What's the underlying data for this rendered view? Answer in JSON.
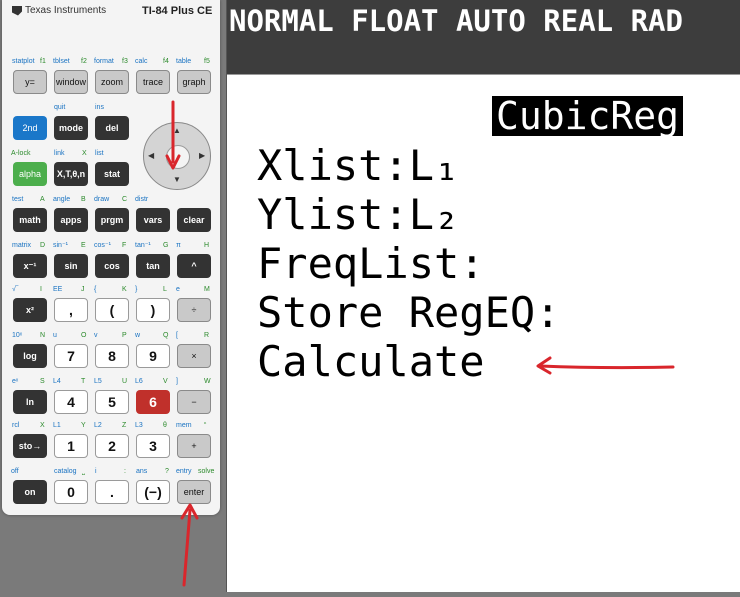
{
  "calculator": {
    "brand": "Texas Instruments",
    "model": "TI-84 Plus CE",
    "rows": [
      {
        "labels": [
          [
            "statplot",
            "b"
          ],
          [
            "f1",
            "g"
          ],
          [
            "tblset",
            "b"
          ],
          [
            "f2",
            "g"
          ],
          [
            "format",
            "b"
          ],
          [
            "f3",
            "g"
          ],
          [
            "calc",
            "b"
          ],
          [
            "f4",
            "g"
          ],
          [
            "table",
            "b"
          ],
          [
            "f5",
            "g"
          ]
        ],
        "keys": [
          [
            "y=",
            "gray"
          ],
          [
            "window",
            "gray"
          ],
          [
            "zoom",
            "gray"
          ],
          [
            "trace",
            "gray"
          ],
          [
            "graph",
            "gray"
          ]
        ]
      },
      {
        "labels": [
          [
            "quit",
            "b"
          ],
          [
            "ins",
            "b"
          ]
        ],
        "keys": [
          [
            "2nd",
            "blue"
          ],
          [
            "mode",
            "dark"
          ],
          [
            "del",
            "dark"
          ]
        ]
      },
      {
        "labels": [
          [
            "A-lock",
            "g"
          ],
          [
            "link",
            "b"
          ],
          [
            "X",
            "g"
          ],
          [
            "list",
            "b"
          ]
        ],
        "keys": [
          [
            "alpha",
            "green"
          ],
          [
            "X,T,θ,n",
            "dark"
          ],
          [
            "stat",
            "dark"
          ]
        ]
      },
      {
        "labels": [
          [
            "test",
            "b"
          ],
          [
            "A",
            "g"
          ],
          [
            "angle",
            "b"
          ],
          [
            "B",
            "g"
          ],
          [
            "draw",
            "b"
          ],
          [
            "C",
            "g"
          ],
          [
            "distr",
            "b"
          ]
        ],
        "keys": [
          [
            "math",
            "dark"
          ],
          [
            "apps",
            "dark"
          ],
          [
            "prgm",
            "dark"
          ],
          [
            "vars",
            "dark"
          ],
          [
            "clear",
            "dark"
          ]
        ]
      },
      {
        "labels": [
          [
            "matrix",
            "b"
          ],
          [
            "D",
            "g"
          ],
          [
            "sin⁻¹",
            "b"
          ],
          [
            "E",
            "g"
          ],
          [
            "cos⁻¹",
            "b"
          ],
          [
            "F",
            "g"
          ],
          [
            "tan⁻¹",
            "b"
          ],
          [
            "G",
            "g"
          ],
          [
            "π",
            "b"
          ],
          [
            "H",
            "g"
          ]
        ],
        "keys": [
          [
            "x⁻¹",
            "dark"
          ],
          [
            "sin",
            "dark"
          ],
          [
            "cos",
            "dark"
          ],
          [
            "tan",
            "dark"
          ],
          [
            "^",
            "dark"
          ]
        ]
      },
      {
        "labels": [
          [
            "√‾",
            "b"
          ],
          [
            "I",
            "g"
          ],
          [
            "EE",
            "b"
          ],
          [
            "J",
            "g"
          ],
          [
            "{",
            "b"
          ],
          [
            "K",
            "g"
          ],
          [
            "}",
            "b"
          ],
          [
            "L",
            "g"
          ],
          [
            "e",
            "b"
          ],
          [
            "M",
            "g"
          ]
        ],
        "keys": [
          [
            "x²",
            "dark"
          ],
          [
            ",",
            "white"
          ],
          [
            "(",
            "white"
          ],
          [
            ")",
            "white"
          ],
          [
            "÷",
            "gray"
          ]
        ]
      },
      {
        "labels": [
          [
            "10ˣ",
            "b"
          ],
          [
            "N",
            "g"
          ],
          [
            "u",
            "b"
          ],
          [
            "O",
            "g"
          ],
          [
            "v",
            "b"
          ],
          [
            "P",
            "g"
          ],
          [
            "w",
            "b"
          ],
          [
            "Q",
            "g"
          ],
          [
            "[",
            "b"
          ],
          [
            "R",
            "g"
          ]
        ],
        "keys": [
          [
            "log",
            "dark"
          ],
          [
            "7",
            "white"
          ],
          [
            "8",
            "white"
          ],
          [
            "9",
            "white"
          ],
          [
            "×",
            "gray"
          ]
        ]
      },
      {
        "labels": [
          [
            "eˣ",
            "b"
          ],
          [
            "S",
            "g"
          ],
          [
            "L4",
            "b"
          ],
          [
            "T",
            "g"
          ],
          [
            "L5",
            "b"
          ],
          [
            "U",
            "g"
          ],
          [
            "L6",
            "b"
          ],
          [
            "V",
            "g"
          ],
          [
            "]",
            "b"
          ],
          [
            "W",
            "g"
          ]
        ],
        "keys": [
          [
            "ln",
            "dark"
          ],
          [
            "4",
            "white"
          ],
          [
            "5",
            "white"
          ],
          [
            "6",
            "red"
          ],
          [
            "−",
            "gray"
          ]
        ]
      },
      {
        "labels": [
          [
            "rcl",
            "b"
          ],
          [
            "X",
            "g"
          ],
          [
            "L1",
            "b"
          ],
          [
            "Y",
            "g"
          ],
          [
            "L2",
            "b"
          ],
          [
            "Z",
            "g"
          ],
          [
            "L3",
            "b"
          ],
          [
            "θ",
            "g"
          ],
          [
            "mem",
            "b"
          ],
          [
            "“",
            "g"
          ]
        ],
        "keys": [
          [
            "sto→",
            "dark"
          ],
          [
            "1",
            "white"
          ],
          [
            "2",
            "white"
          ],
          [
            "3",
            "white"
          ],
          [
            "+",
            "gray"
          ]
        ]
      },
      {
        "labels": [
          [
            "off",
            "b"
          ],
          [
            "catalog",
            "b"
          ],
          [
            "⎵",
            "g"
          ],
          [
            "i",
            "b"
          ],
          [
            ":",
            "g"
          ],
          [
            "ans",
            "b"
          ],
          [
            "?",
            "g"
          ],
          [
            "entry",
            "b"
          ],
          [
            "solve",
            "g"
          ]
        ],
        "keys": [
          [
            "on",
            "dark"
          ],
          [
            "0",
            "white"
          ],
          [
            ".",
            "white"
          ],
          [
            "(−)",
            "white"
          ],
          [
            "enter",
            "gray"
          ]
        ]
      }
    ]
  },
  "screen": {
    "status": "NORMAL FLOAT AUTO REAL RAD",
    "menu_title": "CubicReg",
    "lines": [
      "Xlist:L₁",
      "Ylist:L₂",
      "FreqList:",
      "Store RegEQ:",
      "Calculate"
    ]
  },
  "annotation_color": "#d9262c"
}
